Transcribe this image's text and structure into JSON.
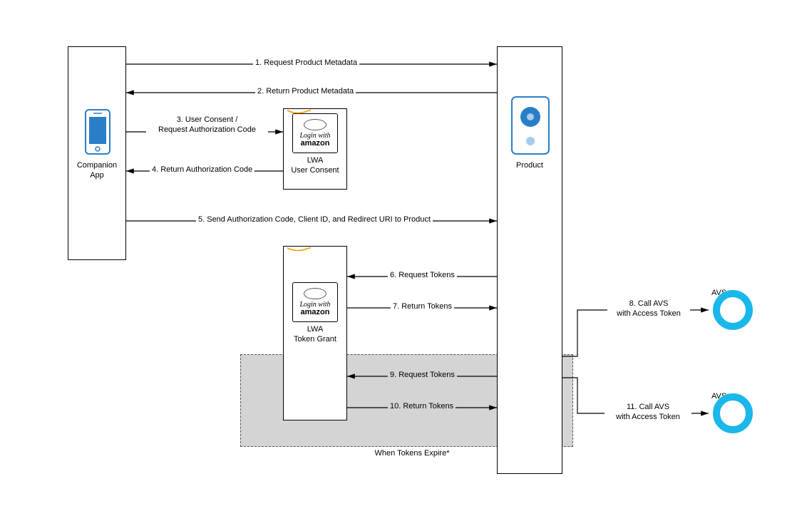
{
  "nodes": {
    "companion": {
      "title": "Companion",
      "subtitle": "App"
    },
    "lwa_consent": {
      "title": "LWA",
      "subtitle": "User Consent",
      "button_top": "Login with",
      "button_bottom": "amazon"
    },
    "lwa_token": {
      "title": "LWA",
      "subtitle": "Token Grant",
      "button_top": "Login with",
      "button_bottom": "amazon"
    },
    "product": {
      "title": "Product"
    },
    "avs1": {
      "title": "AVS"
    },
    "avs2": {
      "title": "AVS"
    }
  },
  "flows": {
    "f1": "1. Request Product Metadata",
    "f2": "2. Return Product Metadata",
    "f3": "3. User Consent / Request Authorization Code",
    "f4": "4. Return Authorization Code",
    "f5": "5. Send Authorization Code, Client ID, and Redirect URI to Product",
    "f6": "6. Request Tokens",
    "f7": "7. Return Tokens",
    "f8": "8. Call AVS with Access Token",
    "f9": "9. Request Tokens",
    "f10": "10. Return Tokens",
    "f11": "11. Call AVS with Access Token"
  },
  "region": {
    "caption": "When Tokens Expire*"
  }
}
